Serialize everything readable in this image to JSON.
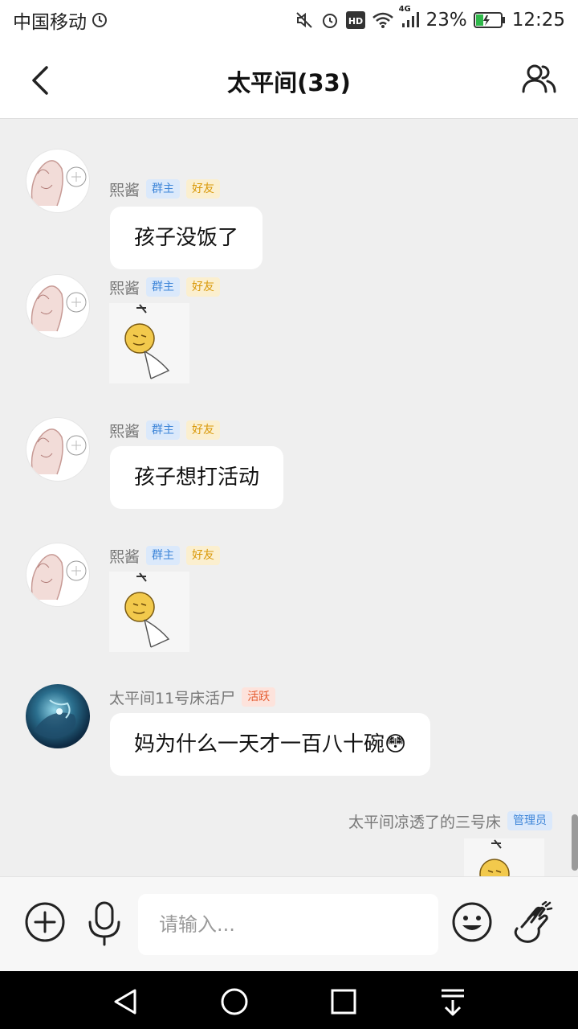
{
  "status_bar": {
    "carrier": "中国移动",
    "network": "4G",
    "battery": "23%",
    "time": "12:25",
    "hd_label": "HD"
  },
  "header": {
    "title": "太平间(33)"
  },
  "messages": [
    {
      "sender": "熙酱",
      "badges": [
        "群主",
        "好友"
      ],
      "type": "text",
      "text": "孩子没饭了"
    },
    {
      "sender": "熙酱",
      "badges": [
        "群主",
        "好友"
      ],
      "type": "sticker"
    },
    {
      "sender": "熙酱",
      "badges": [
        "群主",
        "好友"
      ],
      "type": "text",
      "text": "孩子想打活动"
    },
    {
      "sender": "熙酱",
      "badges": [
        "群主",
        "好友"
      ],
      "type": "sticker"
    },
    {
      "sender": "太平间11号床活尸",
      "badges": [
        "活跃"
      ],
      "type": "text",
      "text": "妈为什么一天才一百八十碗😳"
    },
    {
      "sender": "太平间凉透了的三号床",
      "badges": [
        "管理员"
      ],
      "type": "sticker",
      "self": true
    }
  ],
  "input_bar": {
    "placeholder": "请输入..."
  },
  "colors": {
    "badge_owner": "#3f86d8",
    "badge_friend": "#d9990a",
    "badge_active": "#e45a2e",
    "chat_background": "#efefef"
  },
  "icons": {
    "back": "chevron-left-icon",
    "members": "group-members-icon",
    "add": "plus-circle-icon",
    "voice": "microphone-icon",
    "emoji": "smiley-icon",
    "gesture": "hand-gesture-icon"
  }
}
